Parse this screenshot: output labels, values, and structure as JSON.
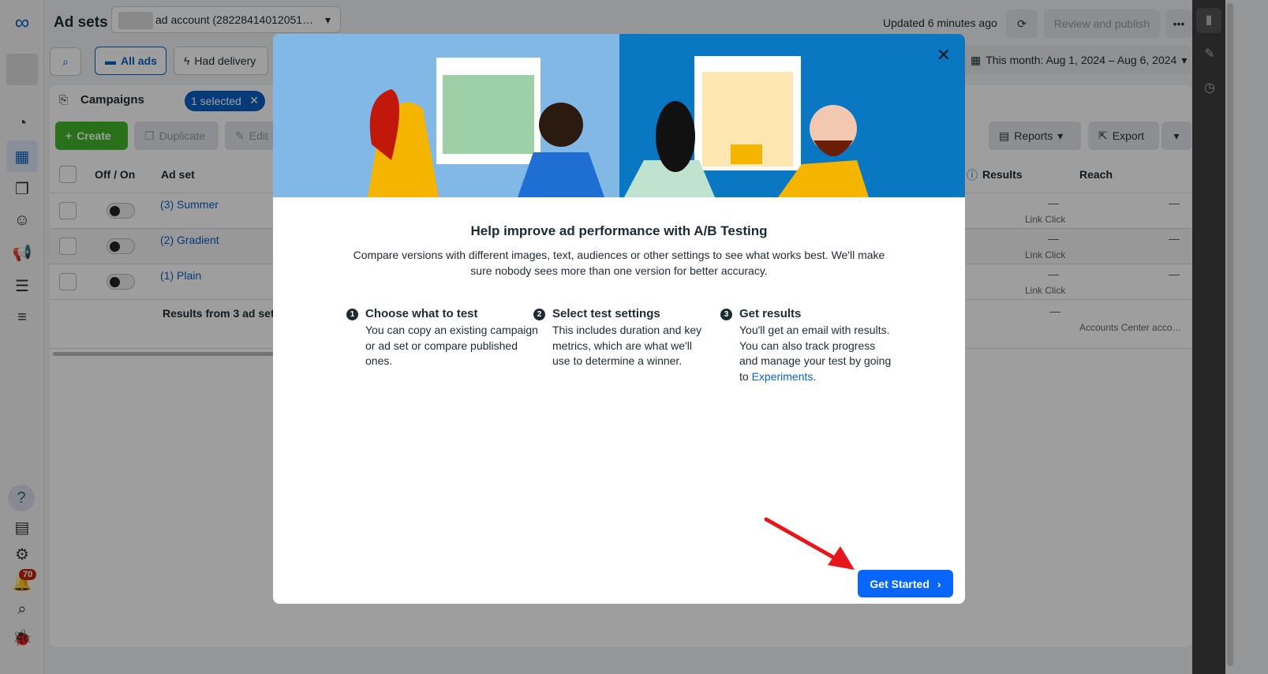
{
  "header": {
    "title": "Ad sets",
    "account": "ad account (28228414012051…",
    "updated": "Updated 6 minutes ago",
    "review_publish": "Review and publish",
    "more": "•••",
    "date_range": "This month: Aug 1, 2024 – Aug 6, 2024"
  },
  "filters": {
    "all_ads": "All ads",
    "had_delivery": "Had delivery"
  },
  "campaigns": {
    "label": "Campaigns",
    "selected": "1 selected"
  },
  "toolbar": {
    "create": "Create",
    "duplicate": "Duplicate",
    "edit": "Edit",
    "reports": "Reports",
    "export": "Export"
  },
  "table": {
    "columns": {
      "toggle": "Off / On",
      "adset": "Ad set",
      "results": "Results",
      "reach": "Reach"
    },
    "rows": [
      {
        "name": "(3) Summer",
        "results": "—",
        "result_type": "Link Click",
        "reach": "—"
      },
      {
        "name": "(2) Gradient",
        "results": "—",
        "result_type": "Link Click",
        "reach": "—"
      },
      {
        "name": "(1) Plain",
        "results": "—",
        "result_type": "Link Click",
        "reach": "—"
      }
    ],
    "summary": {
      "label": "Results from 3 ad sets",
      "results": "—",
      "reach": "Accounts Center acco…"
    }
  },
  "nav": {
    "notifications_count": "70"
  },
  "modal": {
    "title": "Help improve ad performance with A/B Testing",
    "description": "Compare versions with different images, text, audiences or other settings to see what works best. We'll make sure nobody sees more than one version for better accuracy.",
    "steps": [
      {
        "num": "1",
        "title": "Choose what to test",
        "text": "You can copy an existing campaign or ad set or compare published ones."
      },
      {
        "num": "2",
        "title": "Select test settings",
        "text": "This includes duration and key metrics, which are what we'll use to determine a winner."
      },
      {
        "num": "3",
        "title": "Get results",
        "text": "You'll get an email with results. You can also track progress and manage your test by going to ",
        "link": "Experiments",
        "after": "."
      }
    ],
    "get_started": "Get Started"
  },
  "colors": {
    "accent": "#0866ff",
    "create": "#42b72a",
    "illustration_left": "#82b8e6",
    "illustration_right": "#0a77c2",
    "annotation_arrow": "#e8161b"
  }
}
